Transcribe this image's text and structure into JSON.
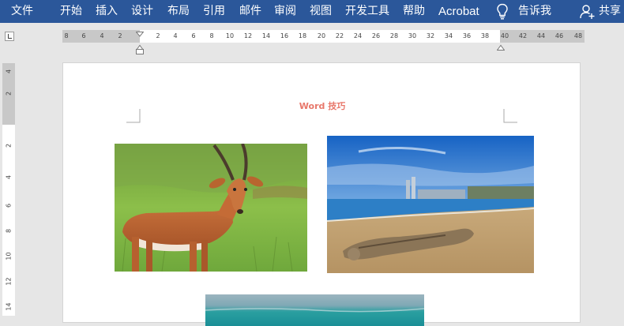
{
  "ribbon": {
    "tabs": [
      {
        "id": "file",
        "label": "文件"
      },
      {
        "id": "home",
        "label": "开始"
      },
      {
        "id": "insert",
        "label": "插入"
      },
      {
        "id": "design",
        "label": "设计"
      },
      {
        "id": "layout",
        "label": "布局"
      },
      {
        "id": "references",
        "label": "引用"
      },
      {
        "id": "mailings",
        "label": "邮件"
      },
      {
        "id": "review",
        "label": "审阅"
      },
      {
        "id": "view",
        "label": "视图"
      },
      {
        "id": "developer",
        "label": "开发工具"
      },
      {
        "id": "help",
        "label": "帮助"
      },
      {
        "id": "acrobat",
        "label": "Acrobat"
      }
    ],
    "tell_me": "告诉我",
    "share": "共享"
  },
  "ruler": {
    "left_labels": [
      "8",
      "6",
      "4",
      "2"
    ],
    "right_labels": [
      "2",
      "4",
      "6",
      "8",
      "10",
      "12",
      "14",
      "16",
      "18",
      "20",
      "22",
      "24",
      "26",
      "28",
      "30",
      "32",
      "34",
      "36",
      "38",
      "40",
      "42",
      "44",
      "46",
      "48"
    ],
    "vertical_labels": [
      "4",
      "2",
      "2",
      "4",
      "6",
      "8",
      "10",
      "12",
      "14"
    ]
  },
  "document": {
    "header": "Word 技巧",
    "images": [
      {
        "name": "antelope-photo",
        "subject": "antelope"
      },
      {
        "name": "beach-photo",
        "subject": "beach"
      },
      {
        "name": "sea-photo",
        "subject": "sea"
      }
    ]
  },
  "colors": {
    "ribbon": "#2b579a",
    "header_text": "#e8776a",
    "workspace": "#e6e6e6"
  }
}
